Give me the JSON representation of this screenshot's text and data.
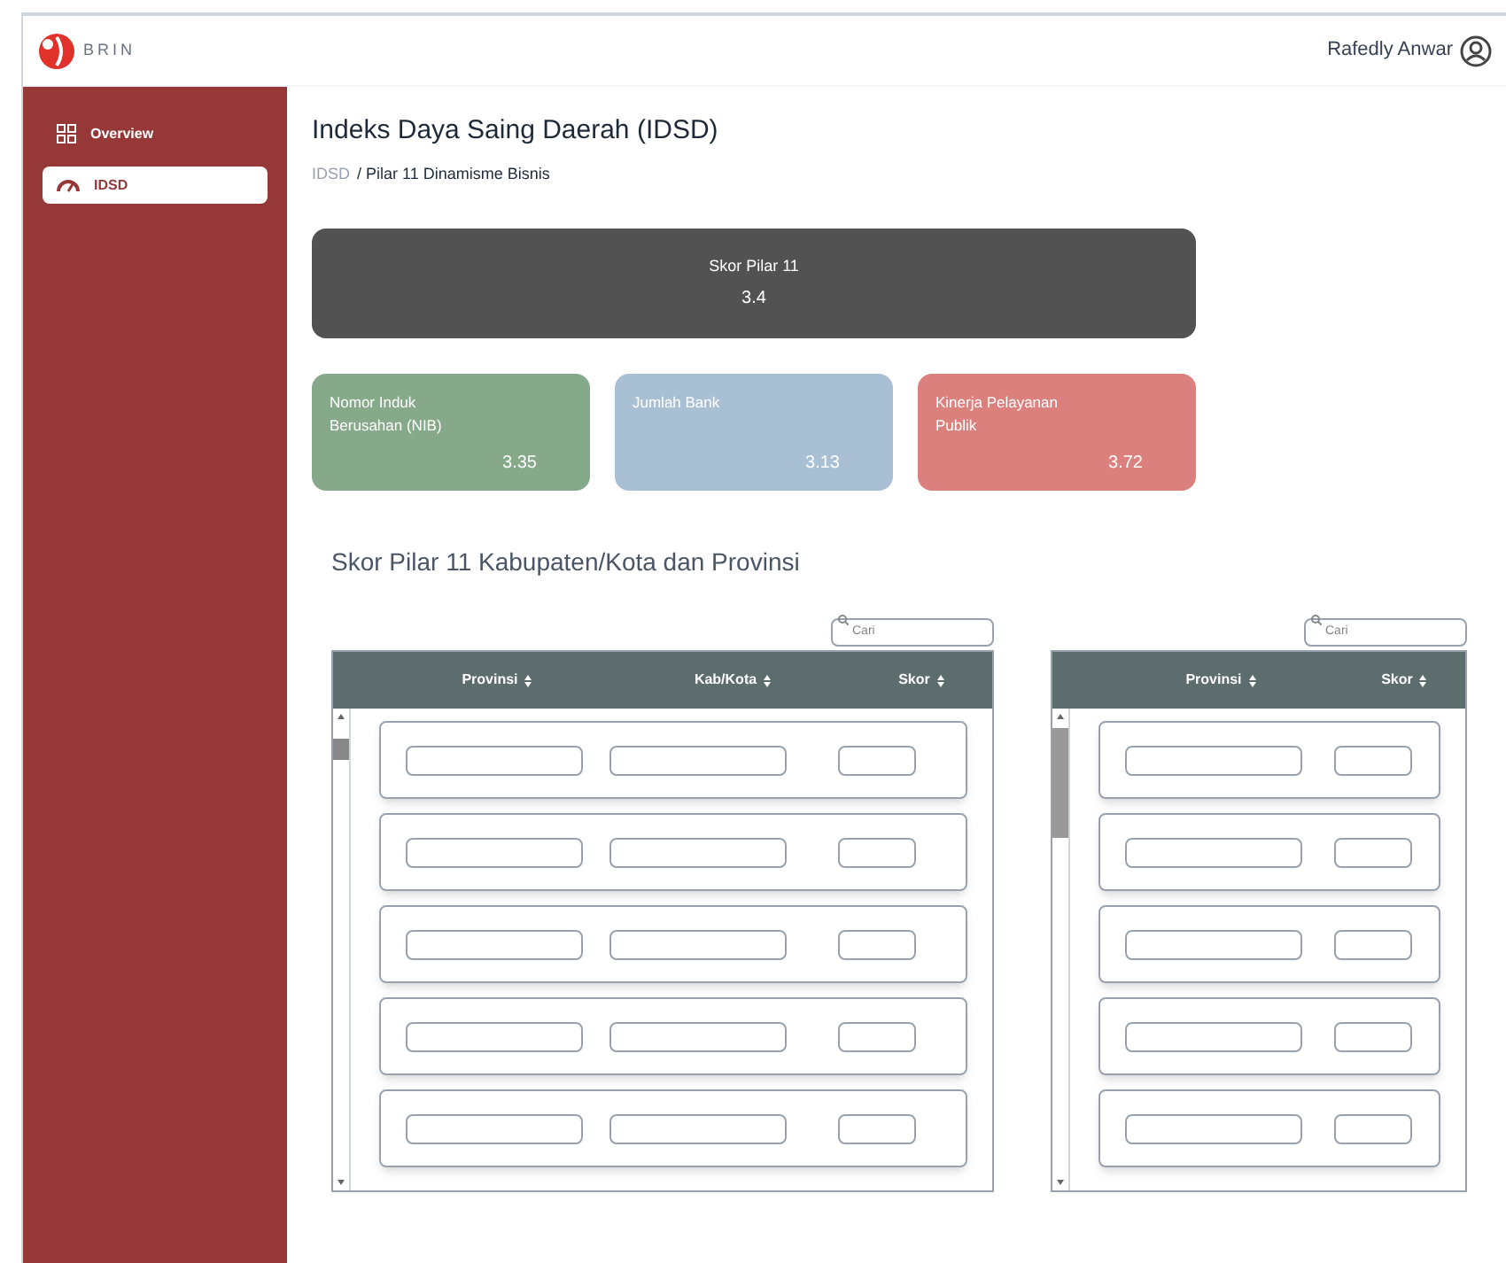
{
  "header": {
    "logo_text": "BRIN",
    "user_name": "Rafedly Anwar"
  },
  "sidebar": {
    "items": [
      {
        "label": "Overview",
        "kind": "grid",
        "selected": false
      },
      {
        "label": "IDSD",
        "kind": "gauge",
        "selected": true
      }
    ]
  },
  "page": {
    "title": "Indeks Daya Saing Daerah (IDSD)",
    "breadcrumb": [
      {
        "label": "IDSD",
        "current": false
      },
      {
        "label": "/ Pilar 11 Dinamisme Bisnis",
        "current": true
      }
    ]
  },
  "summary": {
    "label": "Skor Pilar 11",
    "value": "3.4"
  },
  "cards": [
    {
      "label": "Nomor Induk Berusahan (NIB)",
      "value": "3.35",
      "color": "#86a98a"
    },
    {
      "label": "Jumlah Bank",
      "value": "3.13",
      "color": "#a9c0d4"
    },
    {
      "label": "Kinerja Pelayanan Publik",
      "value": "3.72",
      "color": "#dc807e"
    }
  ],
  "section_title": "Skor Pilar 11 Kabupaten/Kota dan Provinsi",
  "tables": [
    {
      "search_placeholder": "Cari",
      "columns": [
        {
          "label": "Provinsi",
          "kind": "wide"
        },
        {
          "label": "Kab/Kota",
          "kind": "wide"
        },
        {
          "label": "Skor",
          "kind": "narrow"
        }
      ],
      "rows": [
        {
          "kind": "skeleton"
        },
        {
          "kind": "skeleton"
        },
        {
          "kind": "skeleton"
        },
        {
          "kind": "skeleton"
        },
        {
          "kind": "skeleton"
        }
      ]
    },
    {
      "search_placeholder": "Cari",
      "columns": [
        {
          "label": "Provinsi",
          "kind": "wide"
        },
        {
          "label": "Skor",
          "kind": "narrow"
        }
      ],
      "rows": [
        {
          "kind": "skeleton"
        },
        {
          "kind": "skeleton"
        },
        {
          "kind": "skeleton"
        },
        {
          "kind": "skeleton"
        },
        {
          "kind": "skeleton"
        }
      ]
    }
  ]
}
